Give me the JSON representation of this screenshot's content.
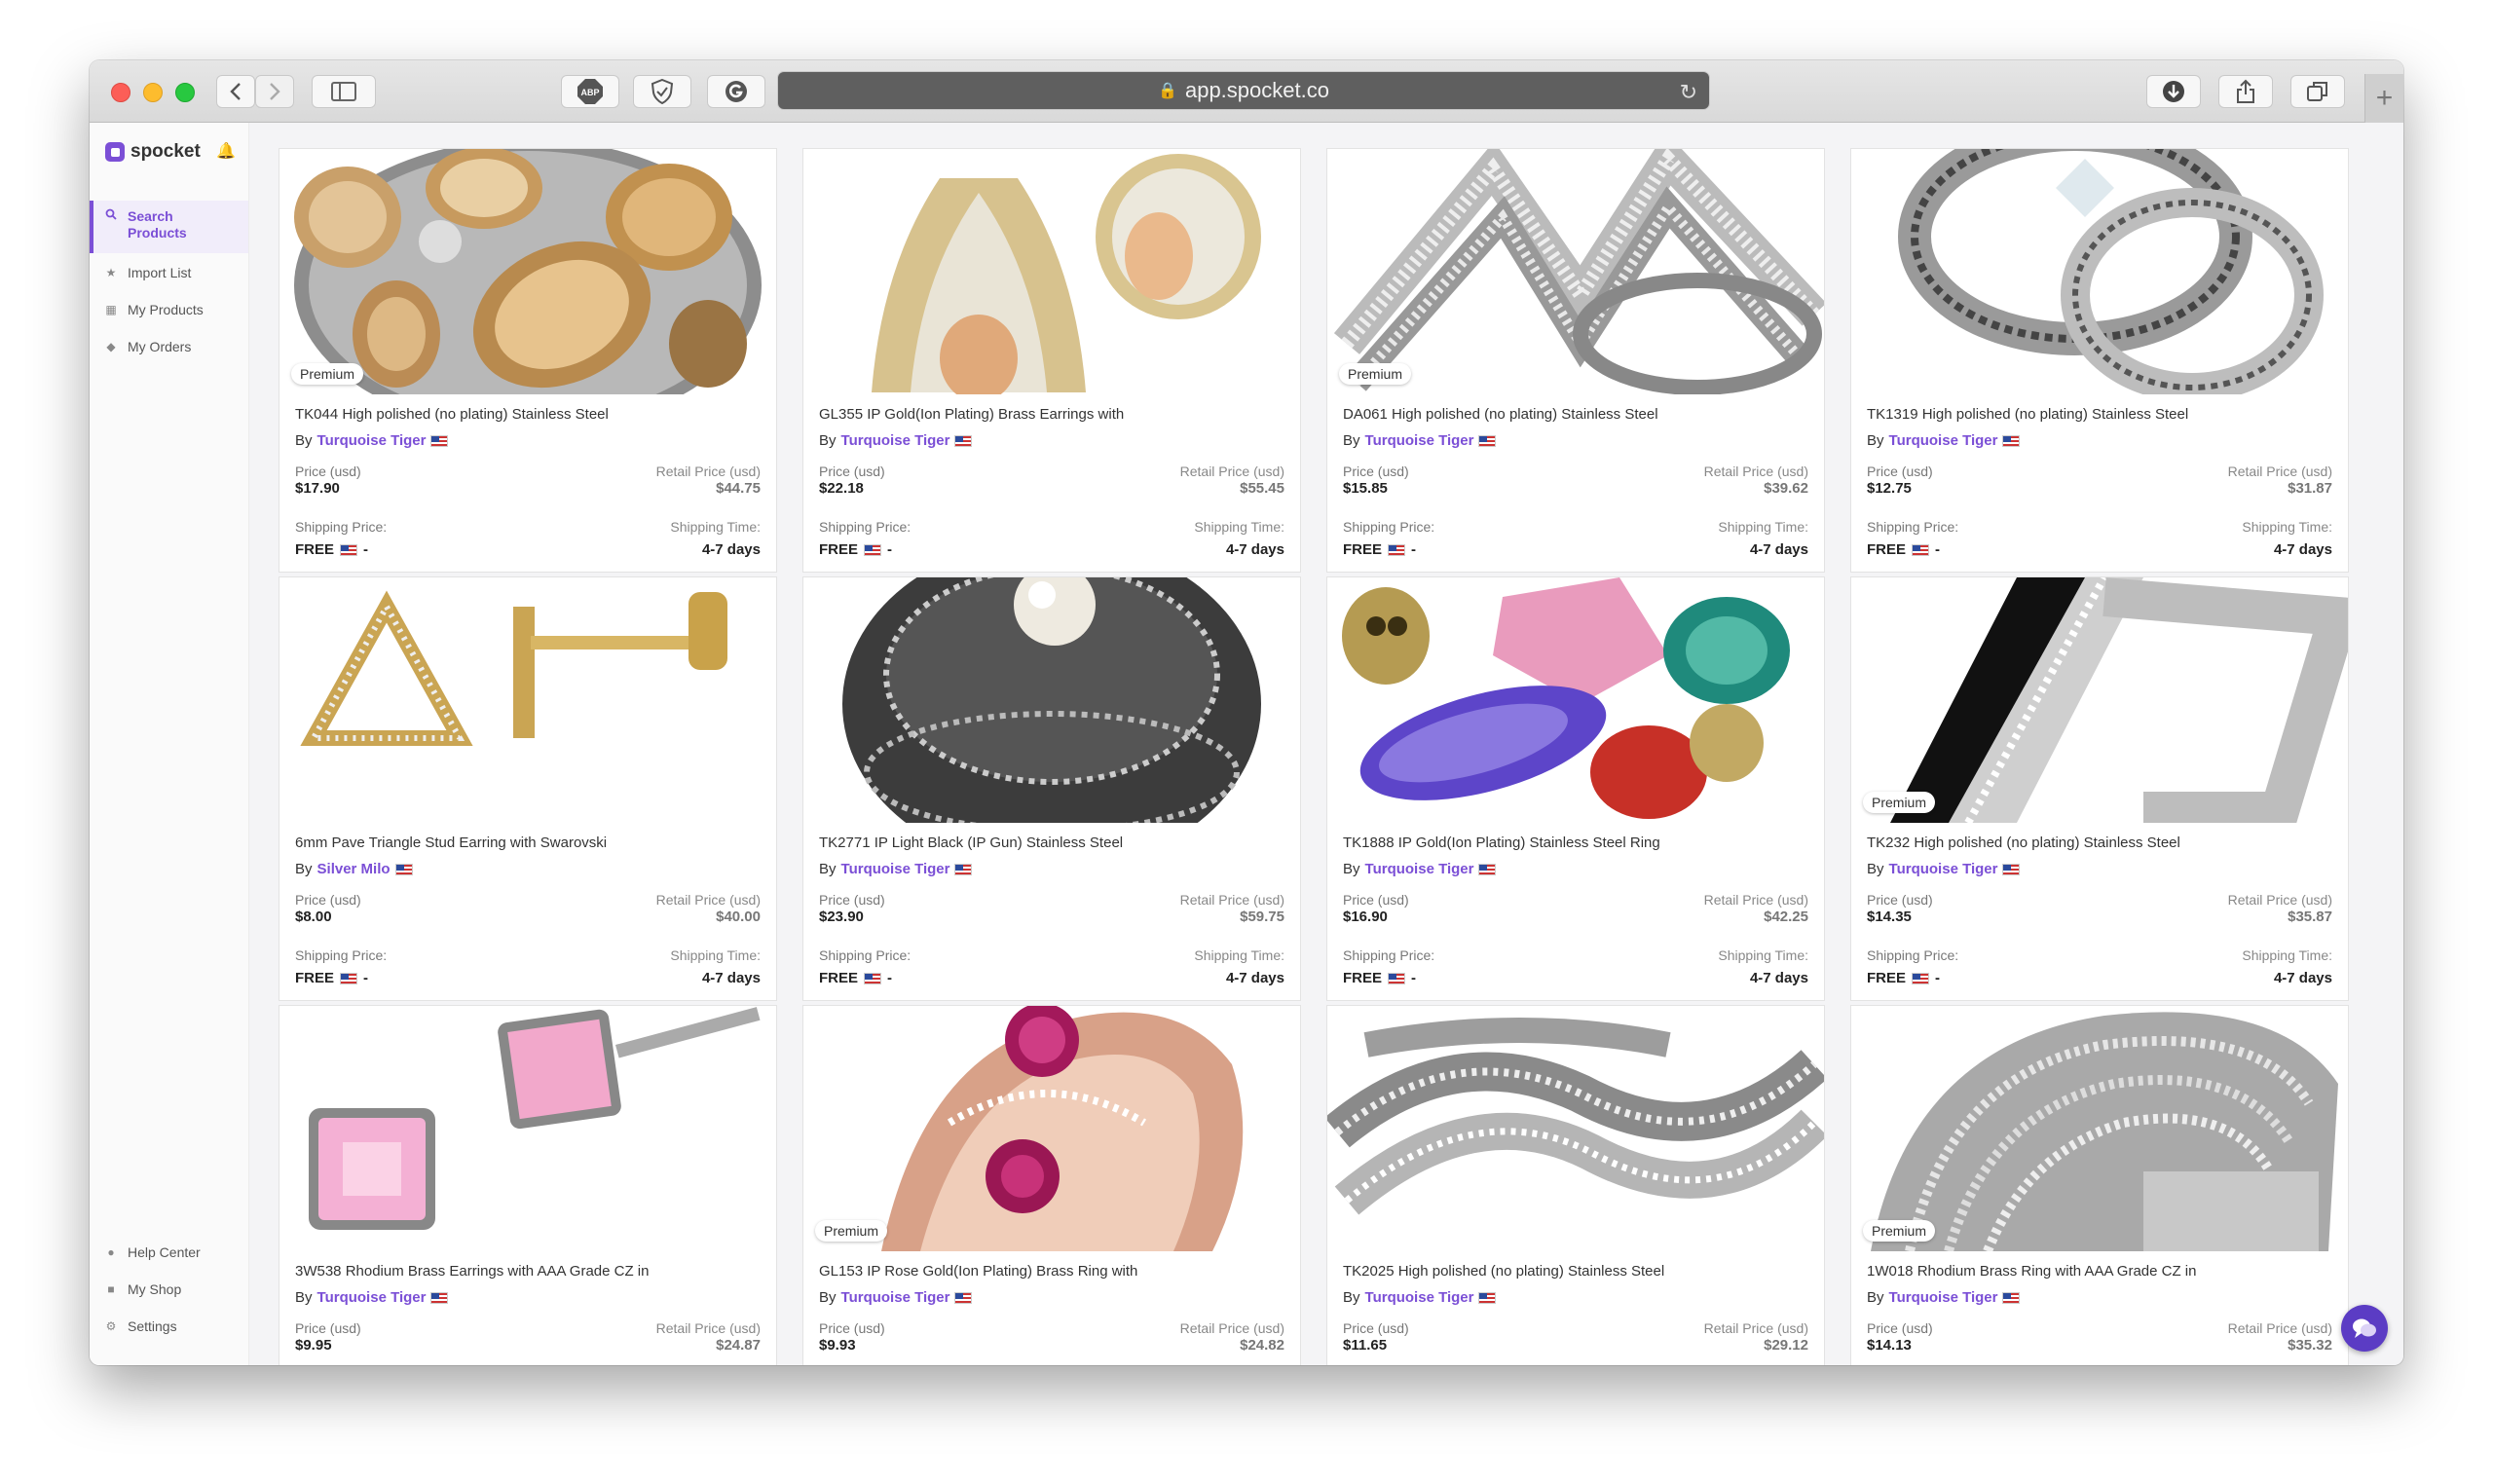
{
  "browser": {
    "url": "app.spocket.co",
    "buttons": {
      "back": "back",
      "forward": "forward",
      "sidebar": "sidebar",
      "abp": "ABP"
    }
  },
  "app": {
    "logo_text": "spocket"
  },
  "sidebar": {
    "items": [
      {
        "label": "Search\nProducts",
        "icon": "search-icon",
        "active": true
      },
      {
        "label": "Import List",
        "icon": "star-icon"
      },
      {
        "label": "My Products",
        "icon": "grid-icon"
      },
      {
        "label": "My Orders",
        "icon": "tag-icon"
      }
    ],
    "bottom_items": [
      {
        "label": "Help Center",
        "icon": "help-icon"
      },
      {
        "label": "My Shop",
        "icon": "shop-icon"
      },
      {
        "label": "Settings",
        "icon": "gear-icon"
      }
    ]
  },
  "labels": {
    "price": "Price (usd)",
    "retail": "Retail Price (usd)",
    "shipping_price": "Shipping Price:",
    "shipping_time": "Shipping Time:",
    "free": "FREE",
    "dash": "-",
    "by": "By",
    "premium": "Premium"
  },
  "products": [
    {
      "title": "TK044 High polished (no plating) Stainless Steel",
      "brand": "Turquoise Tiger",
      "price": "$17.90",
      "retail": "$44.75",
      "time": "4-7 days",
      "premium": true,
      "image": "gold-gems-ring"
    },
    {
      "title": "GL355 IP Gold(Ion Plating) Brass Earrings with",
      "brand": "Turquoise Tiger",
      "price": "$22.18",
      "retail": "$55.45",
      "time": "4-7 days",
      "premium": false,
      "image": "gold-crystal-earrings"
    },
    {
      "title": "DA061 High polished (no plating) Stainless Steel",
      "brand": "Turquoise Tiger",
      "price": "$15.85",
      "retail": "$39.62",
      "time": "4-7 days",
      "premium": true,
      "image": "silver-chevron-ring"
    },
    {
      "title": "TK1319 High polished (no plating) Stainless Steel",
      "brand": "Turquoise Tiger",
      "price": "$12.75",
      "retail": "$31.87",
      "time": "4-7 days",
      "premium": false,
      "image": "silver-ring-set"
    },
    {
      "title": "6mm Pave Triangle Stud Earring with Swarovski",
      "brand": "Silver Milo",
      "price": "$8.00",
      "retail": "$40.00",
      "time": "4-7 days",
      "premium": false,
      "image": "triangle-stud"
    },
    {
      "title": "TK2771 IP Light Black (IP Gun) Stainless Steel",
      "brand": "Turquoise Tiger",
      "price": "$23.90",
      "retail": "$59.75",
      "time": "4-7 days",
      "premium": false,
      "image": "black-pearl-ring"
    },
    {
      "title": "TK1888 IP Gold(Ion Plating) Stainless Steel Ring",
      "brand": "Turquoise Tiger",
      "price": "$16.90",
      "retail": "$42.25",
      "time": "4-7 days",
      "premium": false,
      "image": "skull-gems-ring"
    },
    {
      "title": "TK232 High polished (no plating) Stainless Steel",
      "brand": "Turquoise Tiger",
      "price": "$14.35",
      "retail": "$35.87",
      "time": "4-7 days",
      "premium": true,
      "image": "black-inlay-ring"
    },
    {
      "title": "3W538 Rhodium Brass Earrings with AAA Grade CZ in",
      "brand": "Turquoise Tiger",
      "price": "$9.95",
      "retail": "$24.87",
      "time": "",
      "premium": false,
      "image": "pink-square-studs"
    },
    {
      "title": "GL153 IP Rose Gold(Ion Plating) Brass Ring with",
      "brand": "Turquoise Tiger",
      "price": "$9.93",
      "retail": "$24.82",
      "time": "",
      "premium": true,
      "image": "rose-gold-ring"
    },
    {
      "title": "TK2025 High polished (no plating) Stainless Steel",
      "brand": "Turquoise Tiger",
      "price": "$11.65",
      "retail": "$29.12",
      "time": "",
      "premium": false,
      "image": "silver-wave-ring"
    },
    {
      "title": "1W018 Rhodium Brass Ring with AAA Grade CZ in",
      "brand": "Turquoise Tiger",
      "price": "$14.13",
      "retail": "$35.32",
      "time": "",
      "premium": true,
      "image": "pave-wide-ring"
    }
  ],
  "colors": {
    "accent": "#7b4fd6",
    "chat": "#5b3cc4"
  }
}
